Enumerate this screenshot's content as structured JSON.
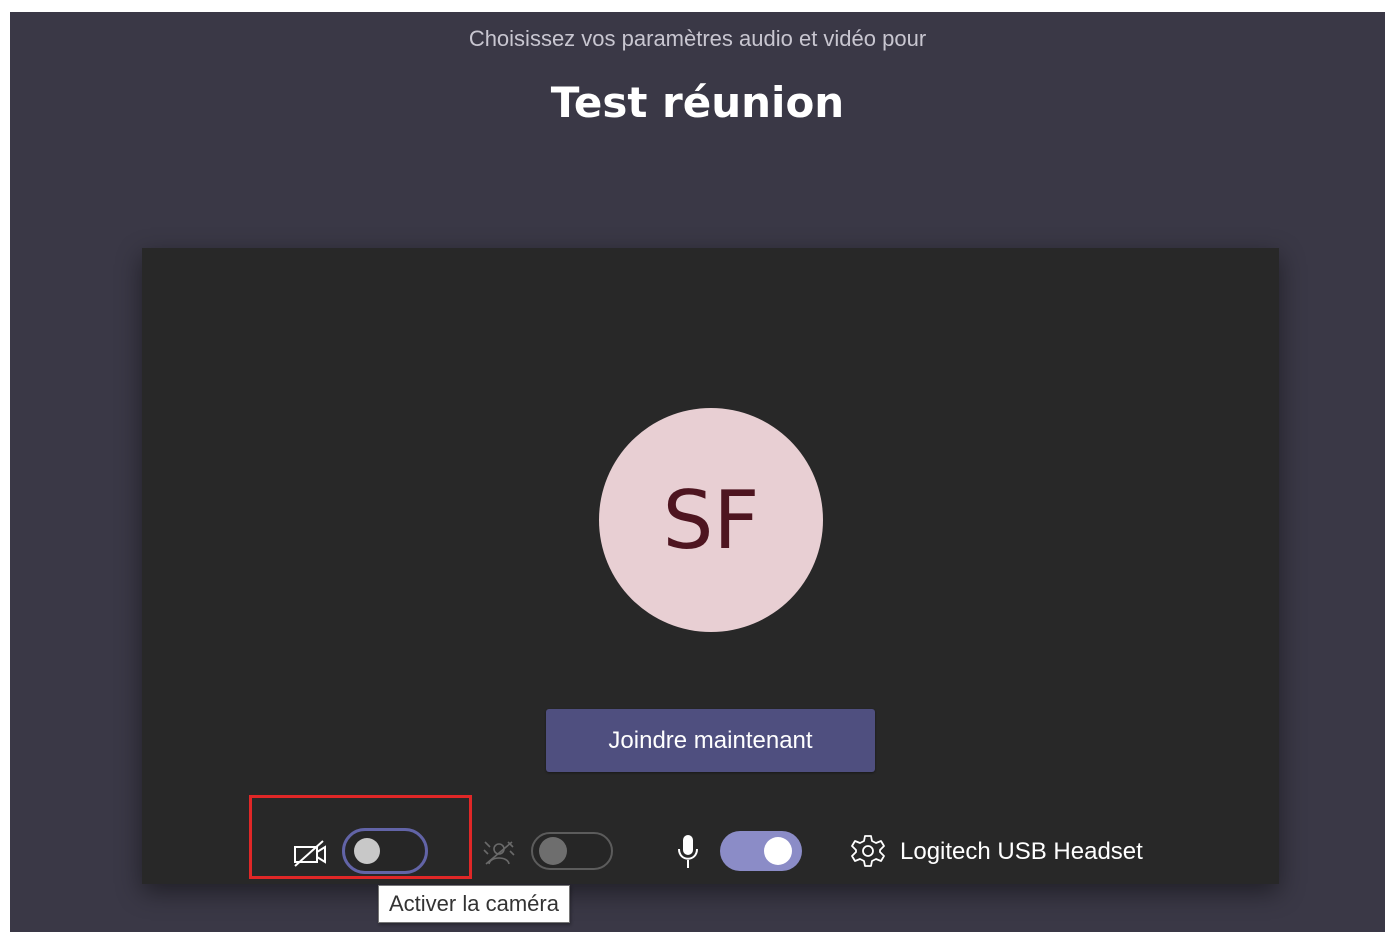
{
  "header": {
    "subtitle": "Choisissez vos paramètres audio et vidéo pour",
    "meeting_title": "Test réunion"
  },
  "preview": {
    "avatar_initials": "SF",
    "avatar_bg": "#e8cfd3",
    "avatar_text_color": "#4e1520"
  },
  "join_button": {
    "label": "Joindre maintenant",
    "color": "#4f4f7f"
  },
  "controls": {
    "camera": {
      "icon": "camera-off-icon",
      "state": "off"
    },
    "background_blur": {
      "icon": "background-blur-icon",
      "state": "off",
      "enabled": false
    },
    "microphone": {
      "icon": "microphone-icon",
      "state": "on",
      "color": "#8b8cc7"
    },
    "device_settings": {
      "icon": "gear-icon",
      "device_label": "Logitech USB Headset"
    }
  },
  "tooltip": {
    "text": "Activer la caméra"
  },
  "annotation": {
    "highlight_color": "#e02727"
  }
}
